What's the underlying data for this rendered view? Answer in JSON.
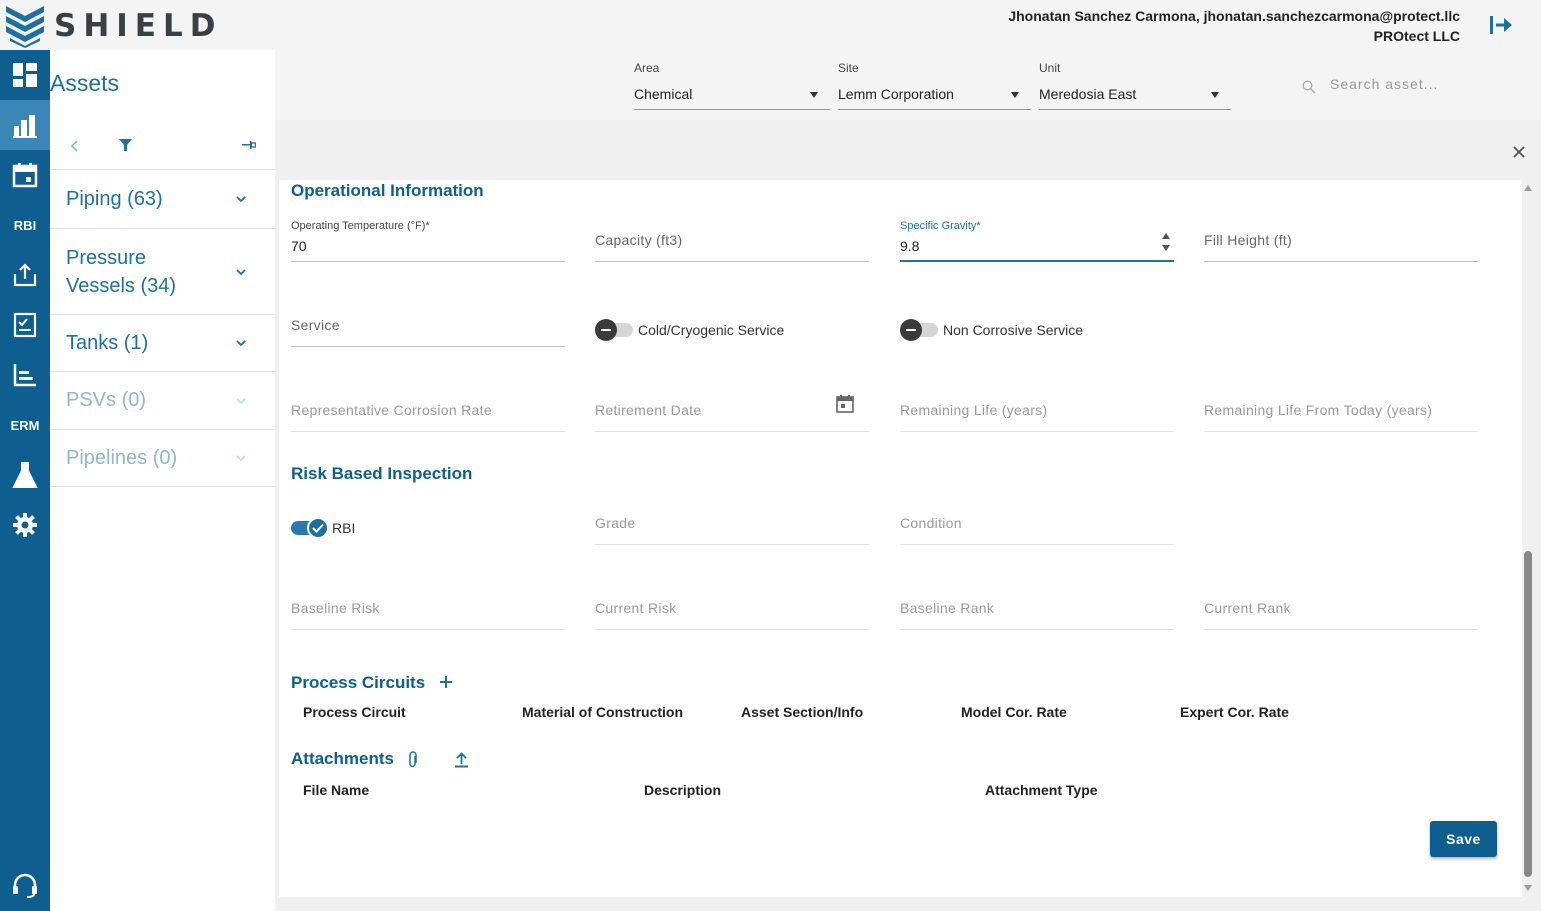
{
  "app": {
    "name": "SHIELD"
  },
  "user": {
    "line1": "Jhonatan Sanchez Carmona, jhonatan.sanchezcarmona@protect.llc",
    "company": "PROtect LLC"
  },
  "rail": {
    "rbi_label": "RBI",
    "erm_label": "ERM"
  },
  "assets": {
    "title": "Assets",
    "categories": [
      {
        "label": "Piping (63)"
      },
      {
        "label_line1": "Pressure",
        "label_line2": "Vessels (34)"
      },
      {
        "label": "Tanks (1)"
      },
      {
        "label": "PSVs (0)"
      },
      {
        "label": "Pipelines (0)"
      }
    ]
  },
  "filters": {
    "area": {
      "label": "Area",
      "value": "Chemical"
    },
    "site": {
      "label": "Site",
      "value": "Lemm Corporation"
    },
    "unit": {
      "label": "Unit",
      "value": "Meredosia East"
    },
    "search_placeholder": "Search asset..."
  },
  "operational": {
    "title": "Operational Information",
    "operating_temperature": {
      "label": "Operating Temperature (°F)*",
      "value": "70"
    },
    "capacity_placeholder": "Capacity (ft3)",
    "specific_gravity": {
      "label": "Specific Gravity*",
      "value": "9.8"
    },
    "fill_height_placeholder": "Fill Height (ft)",
    "service_placeholder": "Service",
    "cold_cryogenic_label": "Cold/Cryogenic Service",
    "non_corrosive_label": "Non Corrosive Service",
    "rep_corrosion_rate_placeholder": "Representative Corrosion Rate",
    "retirement_date_placeholder": "Retirement Date",
    "remaining_life_placeholder": "Remaining Life (years)",
    "remaining_life_today_placeholder": "Remaining Life From Today (years)"
  },
  "rbi": {
    "title": "Risk Based Inspection",
    "toggle_label": "RBI",
    "grade_placeholder": "Grade",
    "condition_placeholder": "Condition",
    "baseline_risk_placeholder": "Baseline Risk",
    "current_risk_placeholder": "Current Risk",
    "baseline_rank_placeholder": "Baseline Rank",
    "current_rank_placeholder": "Current Rank"
  },
  "process_circuits": {
    "title": "Process Circuits",
    "columns": [
      "Process Circuit",
      "Material of Construction",
      "Asset Section/Info",
      "Model Cor. Rate",
      "Expert Cor. Rate"
    ]
  },
  "attachments": {
    "title": "Attachments",
    "columns": [
      "File Name",
      "Description",
      "Attachment Type"
    ]
  },
  "actions": {
    "save_label": "Save"
  },
  "colors": {
    "primary": "#0e5e8f",
    "accent": "#1f6f9f",
    "rail_active": "#3a86b7"
  }
}
